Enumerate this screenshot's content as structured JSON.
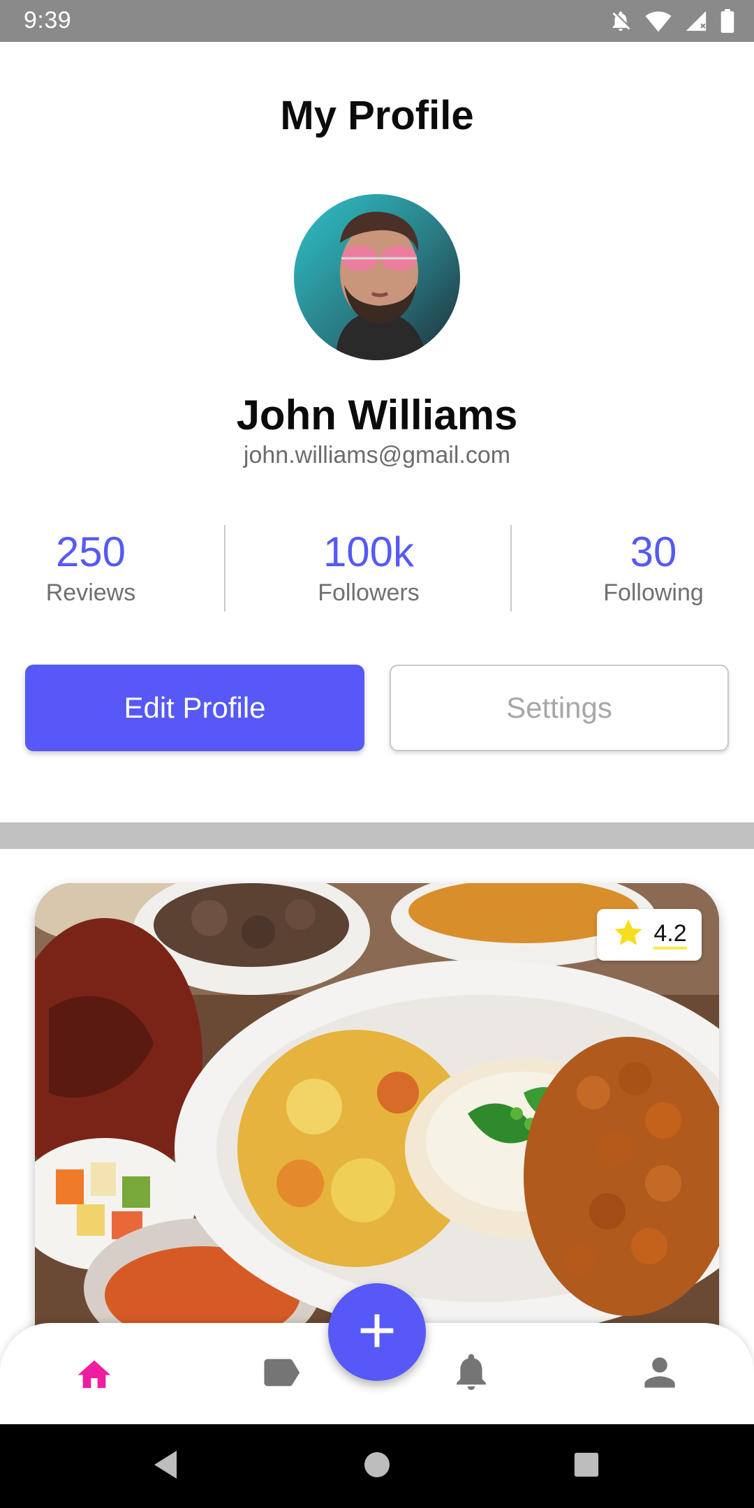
{
  "status_bar": {
    "time": "9:39"
  },
  "header": {
    "title": "My Profile"
  },
  "profile": {
    "name": "John Williams",
    "email": "john.williams@gmail.com"
  },
  "stats": [
    {
      "value": "250",
      "label": "Reviews"
    },
    {
      "value": "100k",
      "label": "Followers"
    },
    {
      "value": "30",
      "label": "Following"
    }
  ],
  "buttons": {
    "edit_label": "Edit Profile",
    "settings_label": "Settings"
  },
  "food_card": {
    "rating": "4.2"
  },
  "bottom_nav": {
    "items": [
      {
        "icon": "home-icon",
        "active": true
      },
      {
        "icon": "tag-icon",
        "active": false
      },
      {
        "icon": "bell-icon",
        "active": false
      },
      {
        "icon": "person-icon",
        "active": false
      }
    ],
    "fab_icon": "plus-icon"
  },
  "colors": {
    "accent": "#5659f7",
    "active_nav": "#ee1ea0",
    "inactive_nav": "#757575"
  }
}
